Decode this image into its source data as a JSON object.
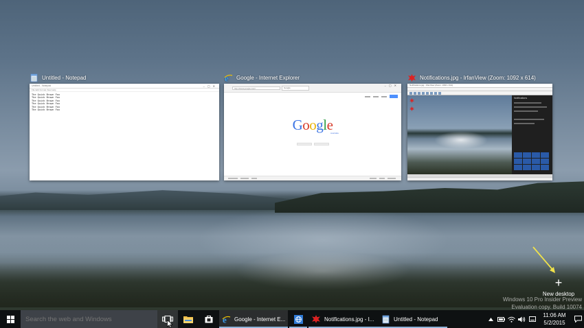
{
  "windows": [
    {
      "title": "Untitled - Notepad",
      "titlebar": "Untitled - Notepad",
      "menu": "File   Edit   Format   View   Help",
      "lines": [
        "The Quick Brown Fox",
        "The Quick Brown Fox",
        "The Quick Brown Fox",
        "The Quick Brown Fox",
        "The Quick Brown Fox",
        "The Quick Brown Fox"
      ]
    },
    {
      "title": "Google - Internet Explorer",
      "address": "http://www.google.com/",
      "tab": "Google",
      "logo": "Google",
      "sublabel": "Australia"
    },
    {
      "title": "Notifications.jpg - IrfanView (Zoom: 1092 x 614)",
      "titlebar": "Notifications.jpg - IrfanView (Zoom: 1092 x 614)",
      "action_center_header": "Notifications"
    }
  ],
  "new_desktop": {
    "label": "New desktop"
  },
  "watermark": {
    "line1": "Windows 10 Pro Insider Preview",
    "line2": "Evaluation copy. Build 10074"
  },
  "taskbar": {
    "search_placeholder": "Search the web and Windows",
    "apps": [
      {
        "label": "Google - Internet E..."
      },
      {
        "label": "Notifications.jpg - I..."
      },
      {
        "label": "Untitled - Notepad"
      }
    ]
  },
  "clock": {
    "time": "11:06 AM",
    "date": "5/2/2015"
  },
  "colors": {
    "taskbar": "#0c0e10",
    "accent": "#8fb3d9",
    "arrow": "#f0e24a"
  }
}
